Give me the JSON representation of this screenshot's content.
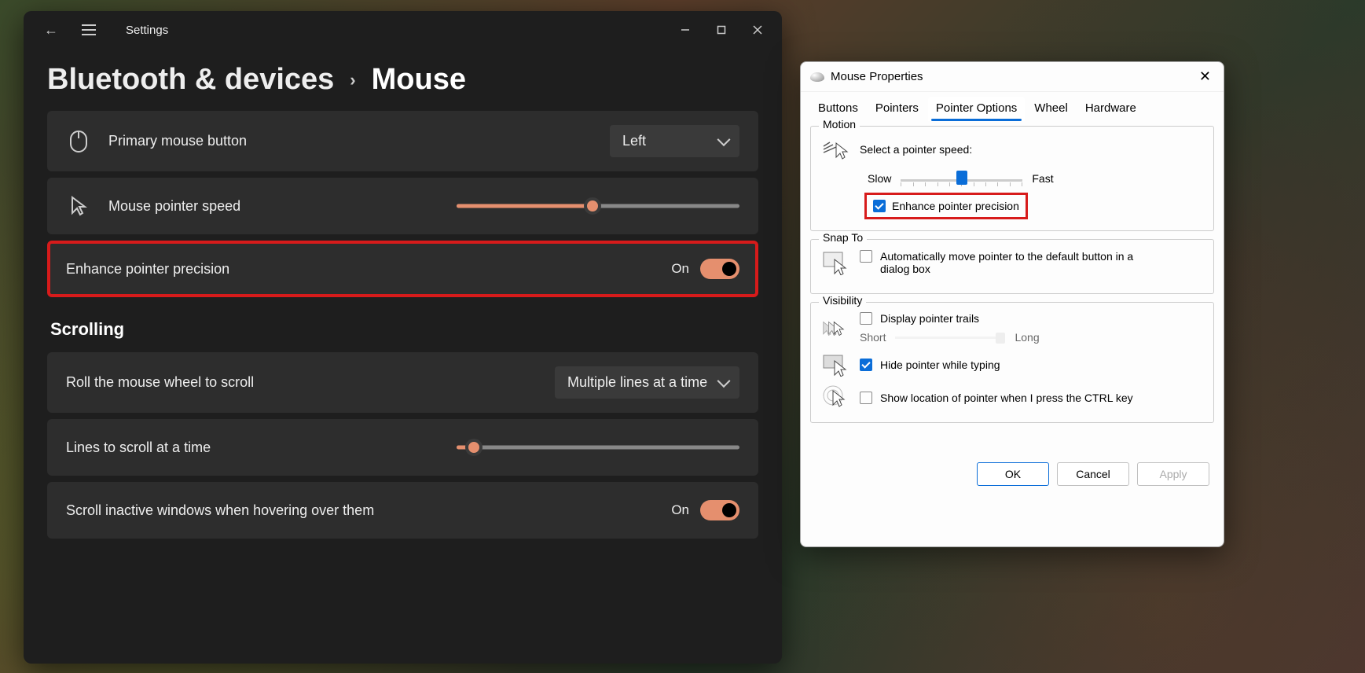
{
  "settings": {
    "window_title": "Settings",
    "breadcrumb_parent": "Bluetooth & devices",
    "breadcrumb_current": "Mouse",
    "primary_button": {
      "label": "Primary mouse button",
      "value": "Left"
    },
    "pointer_speed": {
      "label": "Mouse pointer speed",
      "percent": 48
    },
    "enhance_precision": {
      "label": "Enhance pointer precision",
      "state": "On",
      "enabled": true
    },
    "section_scrolling": "Scrolling",
    "roll_wheel": {
      "label": "Roll the mouse wheel to scroll",
      "value": "Multiple lines at a time"
    },
    "lines_scroll": {
      "label": "Lines to scroll at a time",
      "percent": 6
    },
    "scroll_inactive": {
      "label": "Scroll inactive windows when hovering over them",
      "state": "On",
      "enabled": true
    }
  },
  "mouse_props": {
    "title": "Mouse Properties",
    "tabs": [
      "Buttons",
      "Pointers",
      "Pointer Options",
      "Wheel",
      "Hardware"
    ],
    "active_tab": "Pointer Options",
    "motion": {
      "legend": "Motion",
      "speed_label": "Select a pointer speed:",
      "slow": "Slow",
      "fast": "Fast",
      "precision_label": "Enhance pointer precision",
      "precision_checked": true,
      "slider_percent": 50
    },
    "snap": {
      "legend": "Snap To",
      "auto_label": "Automatically move pointer to the default button in a dialog box",
      "auto_checked": false
    },
    "visibility": {
      "legend": "Visibility",
      "trails_label": "Display pointer trails",
      "trails_checked": false,
      "short": "Short",
      "long": "Long",
      "hide_label": "Hide pointer while typing",
      "hide_checked": true,
      "ctrl_label": "Show location of pointer when I press the CTRL key",
      "ctrl_checked": false
    },
    "buttons": {
      "ok": "OK",
      "cancel": "Cancel",
      "apply": "Apply"
    }
  }
}
